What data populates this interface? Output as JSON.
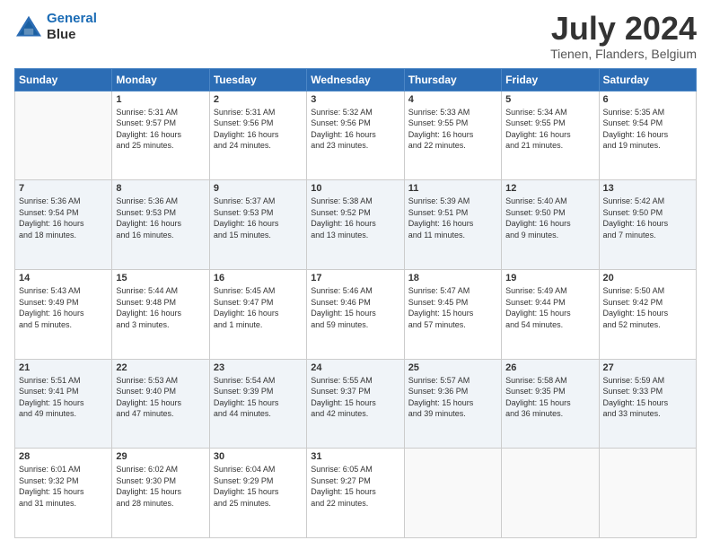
{
  "header": {
    "logo_line1": "General",
    "logo_line2": "Blue",
    "month_year": "July 2024",
    "location": "Tienen, Flanders, Belgium"
  },
  "days_of_week": [
    "Sunday",
    "Monday",
    "Tuesday",
    "Wednesday",
    "Thursday",
    "Friday",
    "Saturday"
  ],
  "weeks": [
    [
      {
        "day": "",
        "text": ""
      },
      {
        "day": "1",
        "text": "Sunrise: 5:31 AM\nSunset: 9:57 PM\nDaylight: 16 hours\nand 25 minutes."
      },
      {
        "day": "2",
        "text": "Sunrise: 5:31 AM\nSunset: 9:56 PM\nDaylight: 16 hours\nand 24 minutes."
      },
      {
        "day": "3",
        "text": "Sunrise: 5:32 AM\nSunset: 9:56 PM\nDaylight: 16 hours\nand 23 minutes."
      },
      {
        "day": "4",
        "text": "Sunrise: 5:33 AM\nSunset: 9:55 PM\nDaylight: 16 hours\nand 22 minutes."
      },
      {
        "day": "5",
        "text": "Sunrise: 5:34 AM\nSunset: 9:55 PM\nDaylight: 16 hours\nand 21 minutes."
      },
      {
        "day": "6",
        "text": "Sunrise: 5:35 AM\nSunset: 9:54 PM\nDaylight: 16 hours\nand 19 minutes."
      }
    ],
    [
      {
        "day": "7",
        "text": "Sunrise: 5:36 AM\nSunset: 9:54 PM\nDaylight: 16 hours\nand 18 minutes."
      },
      {
        "day": "8",
        "text": "Sunrise: 5:36 AM\nSunset: 9:53 PM\nDaylight: 16 hours\nand 16 minutes."
      },
      {
        "day": "9",
        "text": "Sunrise: 5:37 AM\nSunset: 9:53 PM\nDaylight: 16 hours\nand 15 minutes."
      },
      {
        "day": "10",
        "text": "Sunrise: 5:38 AM\nSunset: 9:52 PM\nDaylight: 16 hours\nand 13 minutes."
      },
      {
        "day": "11",
        "text": "Sunrise: 5:39 AM\nSunset: 9:51 PM\nDaylight: 16 hours\nand 11 minutes."
      },
      {
        "day": "12",
        "text": "Sunrise: 5:40 AM\nSunset: 9:50 PM\nDaylight: 16 hours\nand 9 minutes."
      },
      {
        "day": "13",
        "text": "Sunrise: 5:42 AM\nSunset: 9:50 PM\nDaylight: 16 hours\nand 7 minutes."
      }
    ],
    [
      {
        "day": "14",
        "text": "Sunrise: 5:43 AM\nSunset: 9:49 PM\nDaylight: 16 hours\nand 5 minutes."
      },
      {
        "day": "15",
        "text": "Sunrise: 5:44 AM\nSunset: 9:48 PM\nDaylight: 16 hours\nand 3 minutes."
      },
      {
        "day": "16",
        "text": "Sunrise: 5:45 AM\nSunset: 9:47 PM\nDaylight: 16 hours\nand 1 minute."
      },
      {
        "day": "17",
        "text": "Sunrise: 5:46 AM\nSunset: 9:46 PM\nDaylight: 15 hours\nand 59 minutes."
      },
      {
        "day": "18",
        "text": "Sunrise: 5:47 AM\nSunset: 9:45 PM\nDaylight: 15 hours\nand 57 minutes."
      },
      {
        "day": "19",
        "text": "Sunrise: 5:49 AM\nSunset: 9:44 PM\nDaylight: 15 hours\nand 54 minutes."
      },
      {
        "day": "20",
        "text": "Sunrise: 5:50 AM\nSunset: 9:42 PM\nDaylight: 15 hours\nand 52 minutes."
      }
    ],
    [
      {
        "day": "21",
        "text": "Sunrise: 5:51 AM\nSunset: 9:41 PM\nDaylight: 15 hours\nand 49 minutes."
      },
      {
        "day": "22",
        "text": "Sunrise: 5:53 AM\nSunset: 9:40 PM\nDaylight: 15 hours\nand 47 minutes."
      },
      {
        "day": "23",
        "text": "Sunrise: 5:54 AM\nSunset: 9:39 PM\nDaylight: 15 hours\nand 44 minutes."
      },
      {
        "day": "24",
        "text": "Sunrise: 5:55 AM\nSunset: 9:37 PM\nDaylight: 15 hours\nand 42 minutes."
      },
      {
        "day": "25",
        "text": "Sunrise: 5:57 AM\nSunset: 9:36 PM\nDaylight: 15 hours\nand 39 minutes."
      },
      {
        "day": "26",
        "text": "Sunrise: 5:58 AM\nSunset: 9:35 PM\nDaylight: 15 hours\nand 36 minutes."
      },
      {
        "day": "27",
        "text": "Sunrise: 5:59 AM\nSunset: 9:33 PM\nDaylight: 15 hours\nand 33 minutes."
      }
    ],
    [
      {
        "day": "28",
        "text": "Sunrise: 6:01 AM\nSunset: 9:32 PM\nDaylight: 15 hours\nand 31 minutes."
      },
      {
        "day": "29",
        "text": "Sunrise: 6:02 AM\nSunset: 9:30 PM\nDaylight: 15 hours\nand 28 minutes."
      },
      {
        "day": "30",
        "text": "Sunrise: 6:04 AM\nSunset: 9:29 PM\nDaylight: 15 hours\nand 25 minutes."
      },
      {
        "day": "31",
        "text": "Sunrise: 6:05 AM\nSunset: 9:27 PM\nDaylight: 15 hours\nand 22 minutes."
      },
      {
        "day": "",
        "text": ""
      },
      {
        "day": "",
        "text": ""
      },
      {
        "day": "",
        "text": ""
      }
    ]
  ]
}
